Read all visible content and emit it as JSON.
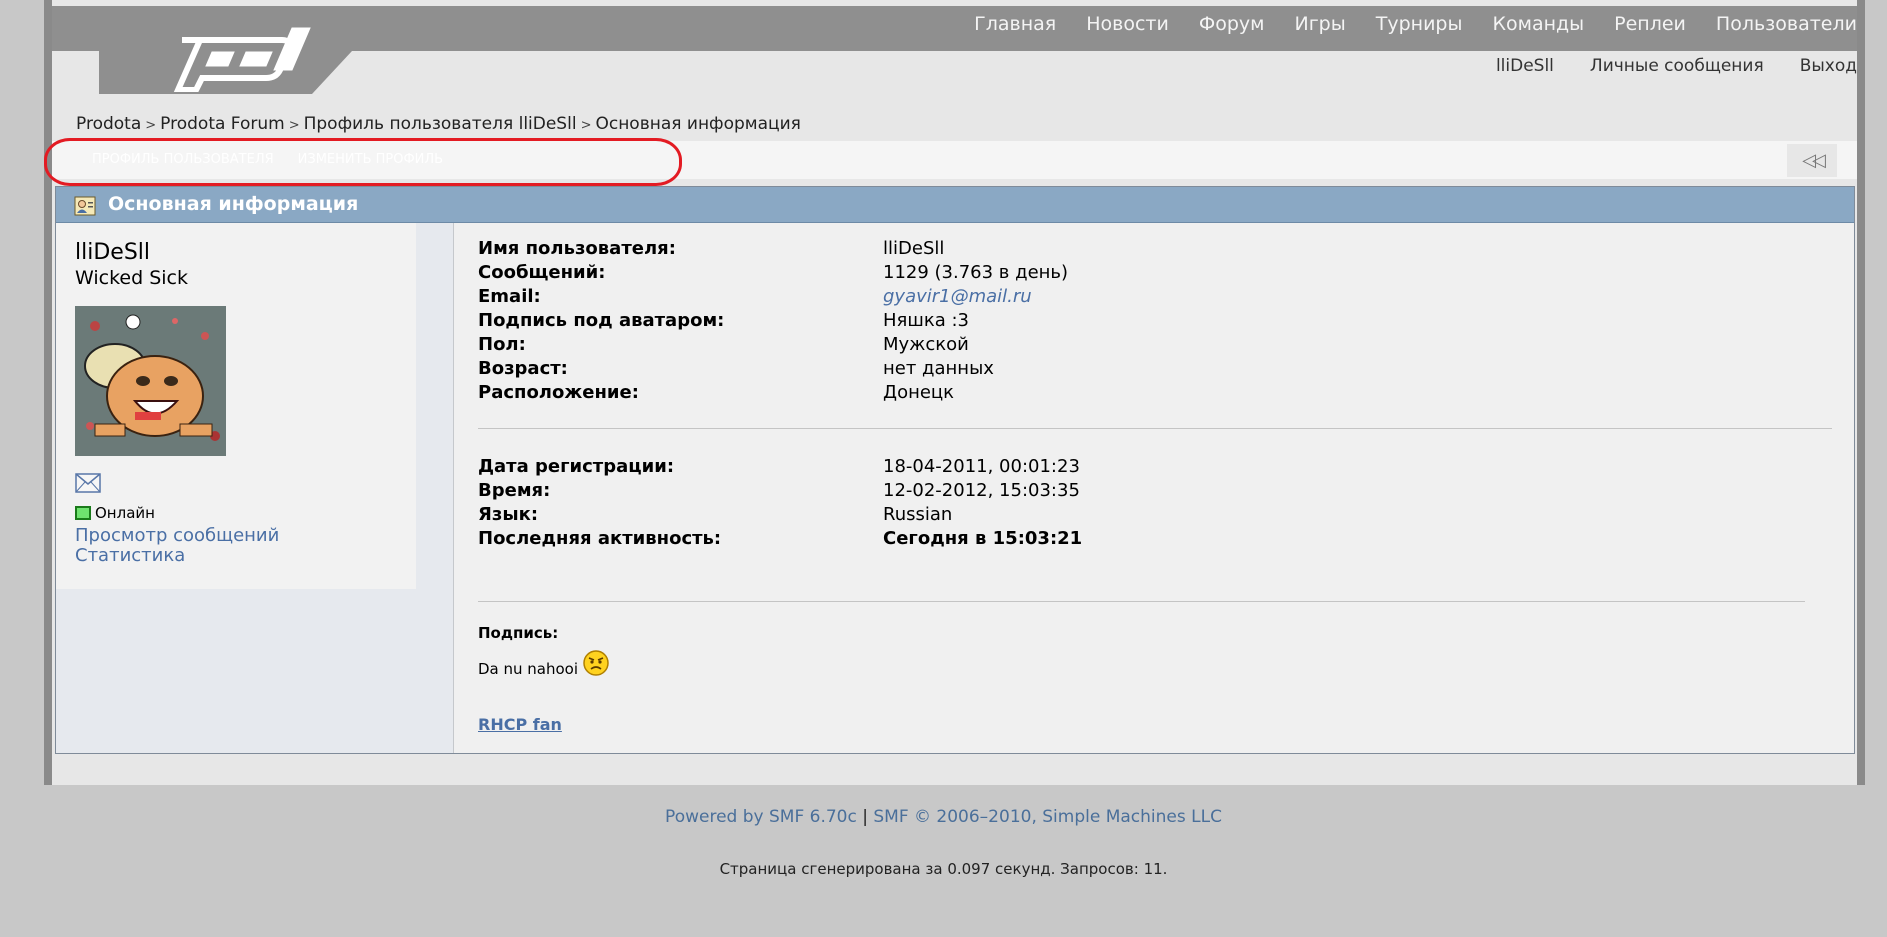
{
  "main_nav": [
    "Главная",
    "Новости",
    "Форум",
    "Игры",
    "Турниры",
    "Команды",
    "Реплеи",
    "Пользователи"
  ],
  "user_nav": [
    "lliDeSll",
    "Личные сообщения",
    "Выход"
  ],
  "breadcrumb": [
    "Prodota",
    "Prodota Forum",
    "Профиль пользователя lliDeSll",
    "Основная информация"
  ],
  "breadcrumb_sep": ">",
  "tabs": [
    "Профиль пользователя",
    "Изменить профиль"
  ],
  "panel_title": "Основная информация",
  "profile": {
    "username": "lliDeSll",
    "title": "Wicked Sick",
    "status": "Онлайн",
    "links": [
      "Просмотр сообщений",
      "Статистика"
    ]
  },
  "info": [
    {
      "k": "Имя пользователя:",
      "v": "lliDeSll"
    },
    {
      "k": "Сообщений:",
      "v": "1129 (3.763 в день)"
    },
    {
      "k": "Email:",
      "v": "gyavir1@mail.ru"
    },
    {
      "k": "Подпись под аватаром:",
      "v": "Няшка :3"
    },
    {
      "k": "Пол:",
      "v": "Мужской"
    },
    {
      "k": "Возраст:",
      "v": "нет данных"
    },
    {
      "k": "Расположение:",
      "v": "Донецк"
    }
  ],
  "info2": [
    {
      "k": "Дата регистрации:",
      "v": "18-04-2011, 00:01:23"
    },
    {
      "k": "Время:",
      "v": "12-02-2012, 15:03:35"
    },
    {
      "k": "Язык:",
      "v": "Russian"
    },
    {
      "k": "Последняя активность:",
      "v": "Сегодня в 15:03:21"
    }
  ],
  "signature": {
    "label": "Подпись:",
    "text": "Da nu nahooi",
    "link": "RHCP fan"
  },
  "footer": {
    "powered": "Powered by SMF 6.70c",
    "sep": "|",
    "copyright": "SMF © 2006–2010, Simple Machines LLC",
    "generated": "Страница сгенерирована за 0.097 секунд. Запросов: 11."
  },
  "icons": {
    "logo": "pd-logo",
    "panel": "user-profile-icon",
    "mail": "envelope-icon",
    "collapse": "double-chevron-left-icon",
    "smiley": "angry-smiley-icon"
  },
  "colors": {
    "accent": "#8aa8c4",
    "link": "#4a6fa5",
    "highlight": "#e31b23",
    "online": "#6fe26f"
  }
}
